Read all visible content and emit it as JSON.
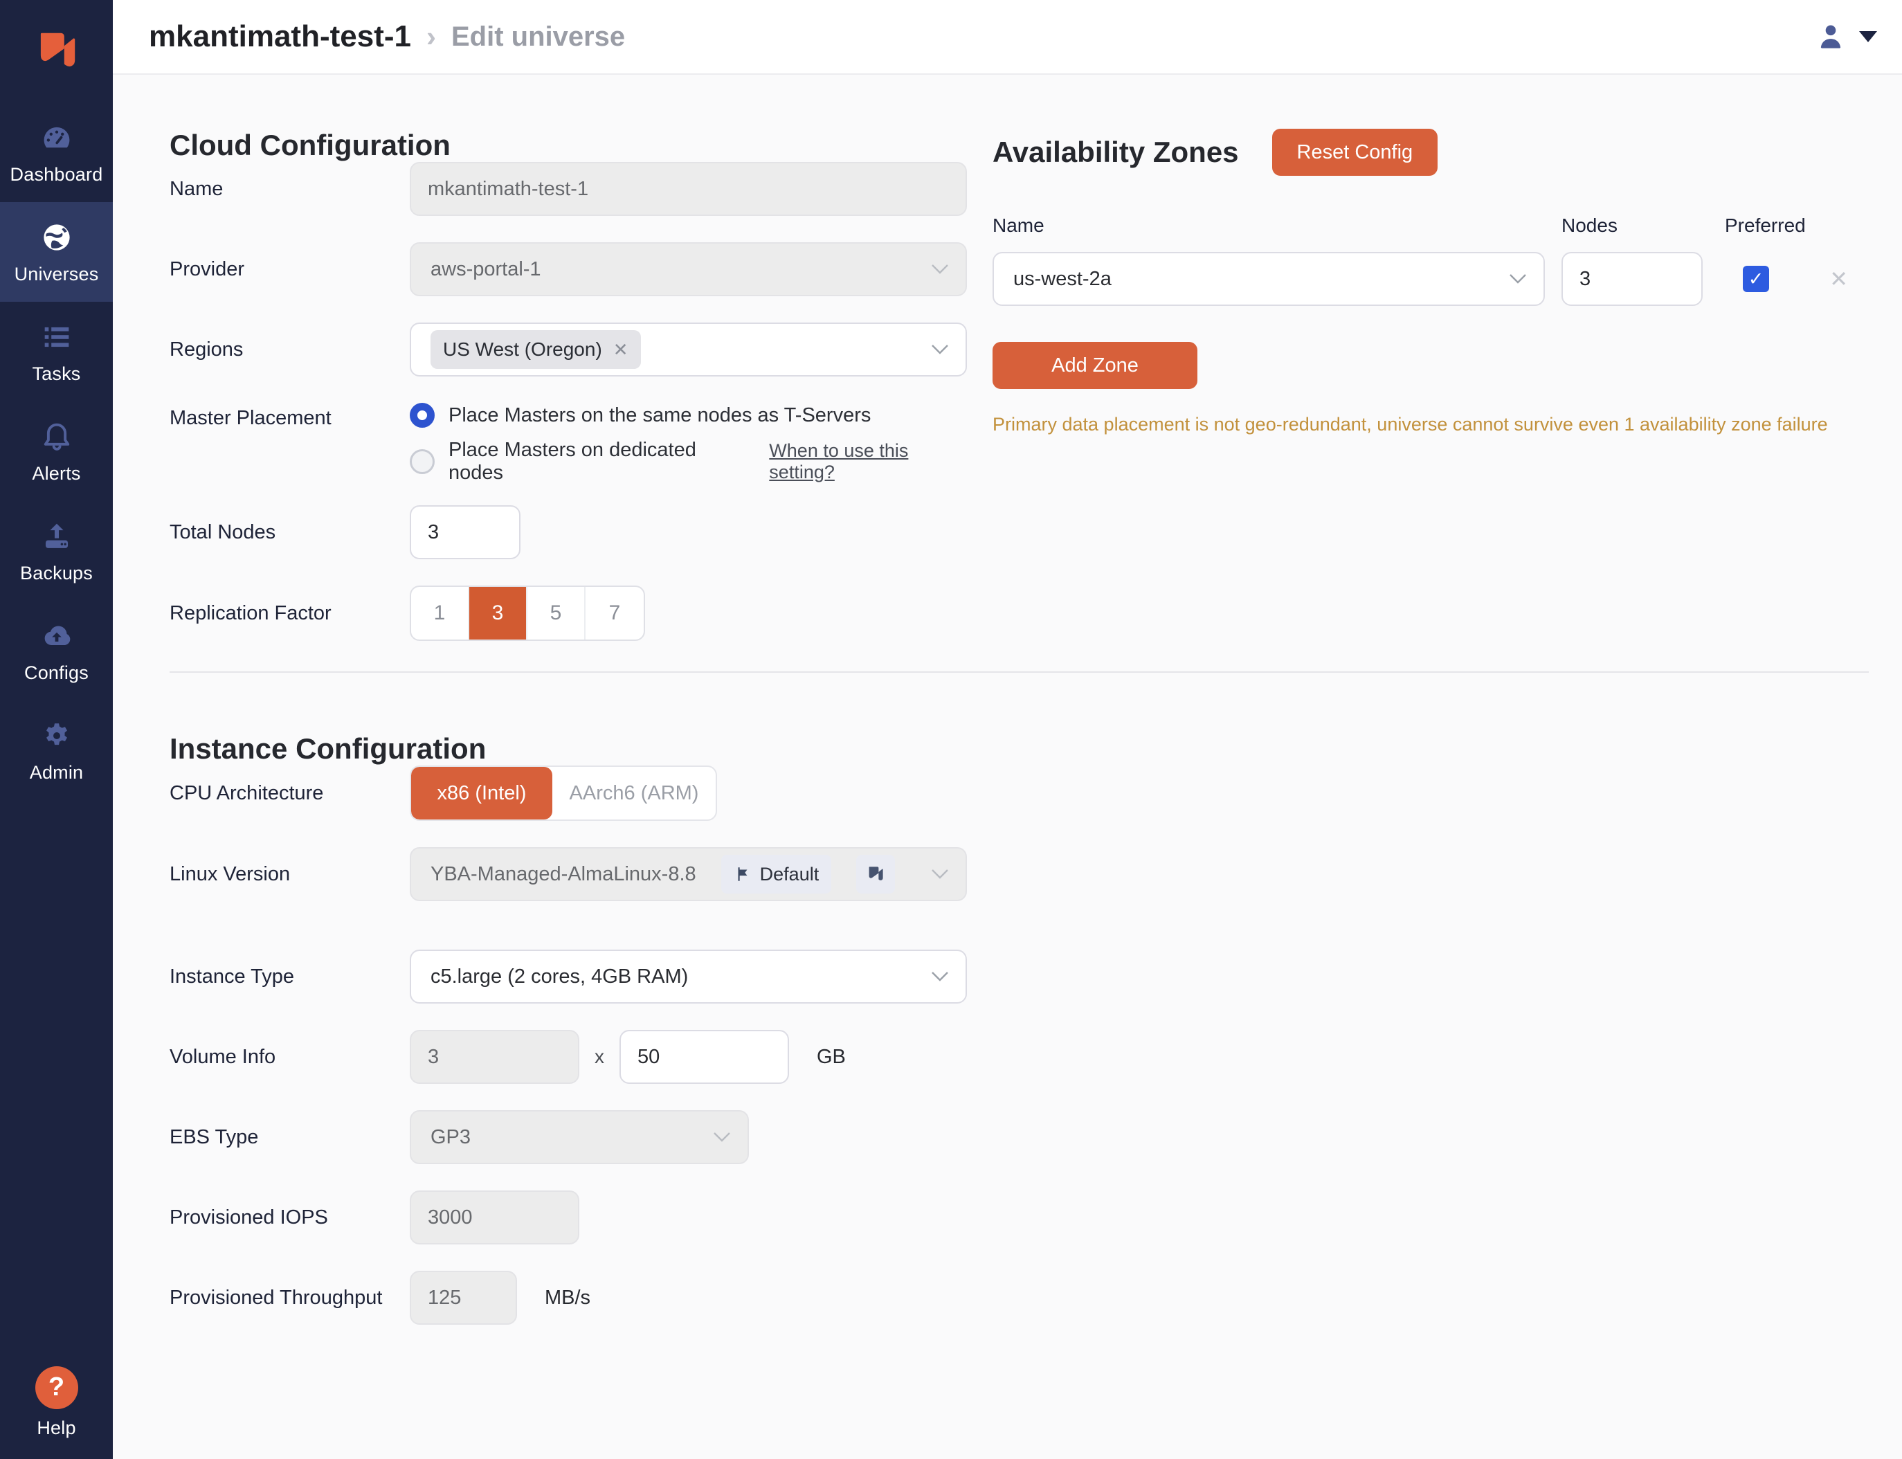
{
  "header": {
    "title": "mkantimath-test-1",
    "separator": "›",
    "subtitle": "Edit universe"
  },
  "sidebar": {
    "items": [
      {
        "label": "Dashboard"
      },
      {
        "label": "Universes"
      },
      {
        "label": "Tasks"
      },
      {
        "label": "Alerts"
      },
      {
        "label": "Backups"
      },
      {
        "label": "Configs"
      },
      {
        "label": "Admin"
      }
    ],
    "help_label": "Help",
    "help_glyph": "?"
  },
  "cloud": {
    "heading": "Cloud Configuration",
    "name_label": "Name",
    "name_value": "mkantimath-test-1",
    "provider_label": "Provider",
    "provider_value": "aws-portal-1",
    "regions_label": "Regions",
    "region_chip": "US West (Oregon)",
    "master_label": "Master Placement",
    "master_option1": "Place Masters on the same nodes as T-Servers",
    "master_option2": "Place Masters on dedicated nodes",
    "master_link": "When to use this setting?",
    "total_nodes_label": "Total Nodes",
    "total_nodes_value": "3",
    "rf_label": "Replication Factor",
    "rf_options": [
      "1",
      "3",
      "5",
      "7"
    ],
    "rf_selected": "3"
  },
  "az": {
    "heading": "Availability Zones",
    "reset_button": "Reset Config",
    "col_name": "Name",
    "col_nodes": "Nodes",
    "col_preferred": "Preferred",
    "zone_value": "us-west-2a",
    "nodes_value": "3",
    "add_button": "Add Zone",
    "warning": "Primary data placement is not geo-redundant, universe cannot survive even 1 availability zone failure"
  },
  "instance": {
    "heading": "Instance Configuration",
    "cpu_label": "CPU Architecture",
    "cpu_selected": "x86 (Intel)",
    "cpu_other": "AArch6 (ARM)",
    "linux_label": "Linux Version",
    "linux_value": "YBA-Managed-AlmaLinux-8.8",
    "linux_badge": "Default",
    "type_label": "Instance Type",
    "type_value": "c5.large (2 cores, 4GB RAM)",
    "volume_label": "Volume Info",
    "volume_count": "3",
    "volume_x": "x",
    "volume_size": "50",
    "volume_unit": "GB",
    "ebs_label": "EBS Type",
    "ebs_value": "GP3",
    "iops_label": "Provisioned IOPS",
    "iops_value": "3000",
    "tp_label": "Provisioned Throughput",
    "tp_value": "125",
    "tp_unit": "MB/s"
  },
  "icons": {
    "chip_remove": "✕",
    "row_remove": "✕",
    "check": "✓"
  },
  "colors": {
    "accent_orange": "#d7603a",
    "rf_selected_orange": "#d25b31",
    "radio_blue": "#2d53cf",
    "checkbox_blue": "#2d5be0",
    "warning_amber": "#c2913c",
    "sidebar_bg": "#1c2340",
    "sidebar_active": "#2f3a63"
  }
}
